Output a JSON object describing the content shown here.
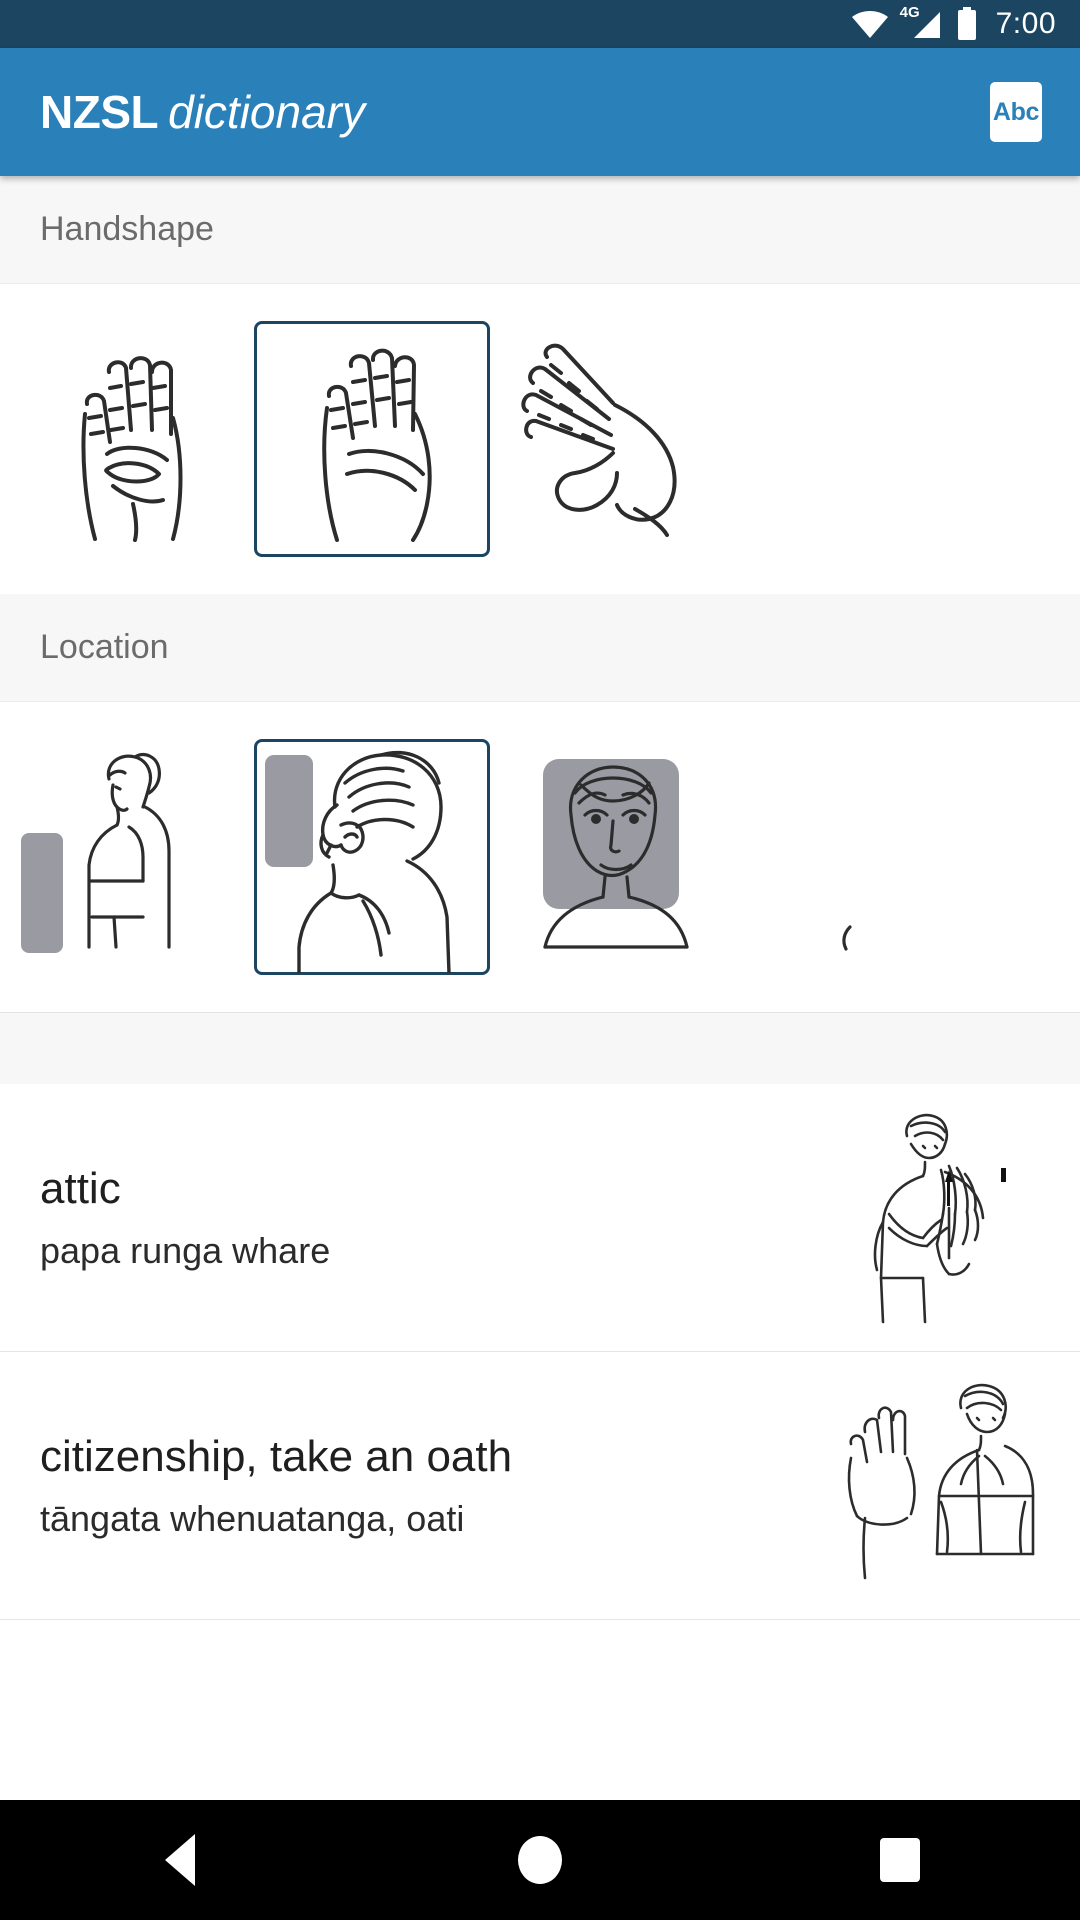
{
  "statusbar": {
    "time": "7:00",
    "network_label": "4G",
    "icons": [
      "wifi-icon",
      "cellular-signal-icon",
      "battery-icon"
    ]
  },
  "appbar": {
    "brand_bold": "NZSL",
    "brand_italic": "dictionary",
    "action_label": "Abc",
    "background_color": "#2a80b9"
  },
  "filters": [
    {
      "title": "Handshape",
      "options": [
        {
          "name": "flat-hand-thumb-across-palm",
          "selected": false
        },
        {
          "name": "flat-hand-palm-forward",
          "selected": true
        },
        {
          "name": "bent-flat-hand-angled",
          "selected": false
        }
      ]
    },
    {
      "title": "Location",
      "options": [
        {
          "name": "body-side-view-torso-space",
          "selected": false
        },
        {
          "name": "head-side-view-beside-face",
          "selected": true
        },
        {
          "name": "head-front-view-face-area",
          "selected": false
        },
        {
          "name": "partial-next-option",
          "selected": false
        }
      ]
    }
  ],
  "results": [
    {
      "gloss": "attic",
      "maori": "papa runga whare",
      "thumb": "sign-illustration-attic"
    },
    {
      "gloss": "citizenship, take an oath",
      "maori": "tāngata whenuatanga, oati",
      "thumb": "sign-illustration-citizenship"
    }
  ],
  "navbar": {
    "back_label": "back-icon",
    "home_label": "home-icon",
    "recents_label": "recents-icon"
  },
  "colors": {
    "selected_border": "#1b4560",
    "section_background": "#f7f7f7",
    "location_marker": "#9a9aa2"
  }
}
